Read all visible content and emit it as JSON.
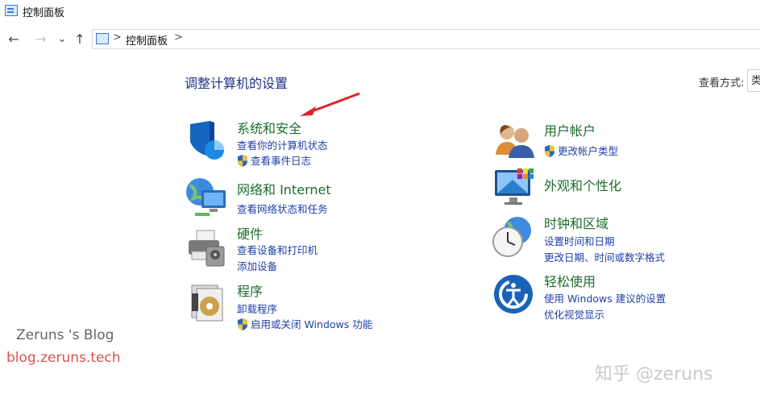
{
  "window": {
    "title": "控制面板"
  },
  "nav": {
    "back": "←",
    "forward": "→",
    "recent": "⌄",
    "up": "↑"
  },
  "address": {
    "separator": ">",
    "crumb": "控制面板"
  },
  "main": {
    "heading": "调整计算机的设置",
    "view_by_label": "查看方式:",
    "view_by_value": "类"
  },
  "categories_left": [
    {
      "title": "系统和安全",
      "links": [
        "查看你的计算机状态",
        "查看事件日志"
      ]
    },
    {
      "title": "网络和 Internet",
      "links": [
        "查看网络状态和任务"
      ]
    },
    {
      "title": "硬件",
      "links": [
        "查看设备和打印机",
        "添加设备"
      ]
    },
    {
      "title": "程序",
      "links": [
        "卸载程序",
        "启用或关闭 Windows 功能"
      ]
    }
  ],
  "categories_right": [
    {
      "title": "用户帐户",
      "links": [
        "更改帐户类型"
      ]
    },
    {
      "title": "外观和个性化",
      "links": []
    },
    {
      "title": "时钟和区域",
      "links": [
        "设置时间和日期",
        "更改日期、时间或数字格式"
      ]
    },
    {
      "title": "轻松使用",
      "links": [
        "使用 Windows 建议的设置",
        "优化视觉显示"
      ]
    }
  ],
  "watermark": {
    "blog_name": "Zeruns 's Blog",
    "blog_url": "blog.zeruns.tech",
    "zhihu": "知乎 @zeruns"
  },
  "colors": {
    "category_title": "#1d6d2c",
    "link": "#1e3fa8",
    "heading": "#1e3287",
    "annotation_arrow": "#d9262b"
  }
}
